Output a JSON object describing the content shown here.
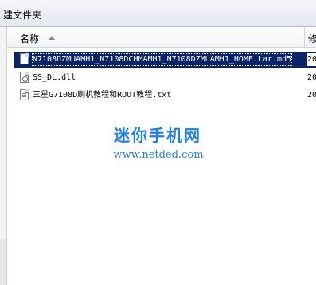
{
  "toolbar": {
    "new_folder_label": "建文件夹"
  },
  "columns": {
    "name": "名称",
    "modified": "修"
  },
  "files": [
    {
      "name": "N7108DZMUAMH1_N7108DCHMAMH1_N7108DZMUAMH1_HOME.tar.md5",
      "date": "20",
      "icon": "file-icon",
      "selected": true
    },
    {
      "name": "SS_DL.dll",
      "date": "20",
      "icon": "dll-file-icon",
      "selected": false
    },
    {
      "name": "三星G7108D刷机教程和ROOT教程.txt",
      "date": "20",
      "icon": "txt-file-icon",
      "selected": false
    }
  ],
  "watermark": {
    "title": "迷你手机网",
    "url": "www.netded.com"
  },
  "colors": {
    "selection": "#0a246a",
    "watermark": "#1e7fe6"
  }
}
